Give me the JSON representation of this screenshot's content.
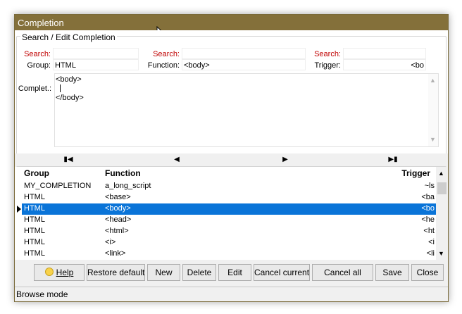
{
  "window": {
    "title": "Completion"
  },
  "groupbox": {
    "title": "Search / Edit Completion"
  },
  "search": {
    "group": {
      "search_label": "Search:",
      "search_value": "",
      "field_label": "Group:",
      "field_value": "HTML"
    },
    "function": {
      "search_label": "Search:",
      "search_value": "",
      "field_label": "Function:",
      "field_value": "<body>"
    },
    "trigger": {
      "search_label": "Search:",
      "search_value": "",
      "field_label": "Trigger:",
      "field_value": "<bo"
    }
  },
  "completion": {
    "label": "Complet.:",
    "lines": [
      "<body>",
      "",
      "</body>"
    ]
  },
  "navigator": {
    "first_icon": "first-record-icon",
    "prev_icon": "prior-record-icon",
    "next_icon": "next-record-icon",
    "last_icon": "last-record-icon"
  },
  "grid": {
    "columns": {
      "group": "Group",
      "function": "Function",
      "trigger": "Trigger"
    },
    "rows": [
      {
        "group": "MY_COMPLETION",
        "function": "a_long_script",
        "trigger": "~ls"
      },
      {
        "group": "HTML",
        "function": "<base>",
        "trigger": "<ba"
      },
      {
        "group": "HTML",
        "function": "<body>",
        "trigger": "<bo",
        "selected": true
      },
      {
        "group": "HTML",
        "function": "<head>",
        "trigger": "<he"
      },
      {
        "group": "HTML",
        "function": "<html>",
        "trigger": "<ht"
      },
      {
        "group": "HTML",
        "function": "<i>",
        "trigger": "<i"
      },
      {
        "group": "HTML",
        "function": "<link>",
        "trigger": "<li"
      }
    ]
  },
  "buttons": {
    "help": "Help",
    "restore_default": "Restore default",
    "new": "New",
    "delete": "Delete",
    "edit": "Edit",
    "cancel_current": "Cancel current",
    "cancel_all": "Cancel all",
    "save": "Save",
    "close": "Close"
  },
  "status": {
    "text": "Browse mode"
  },
  "colors": {
    "titlebar": "#84703a",
    "selection": "#0a74d8",
    "search_label": "#c00000"
  }
}
